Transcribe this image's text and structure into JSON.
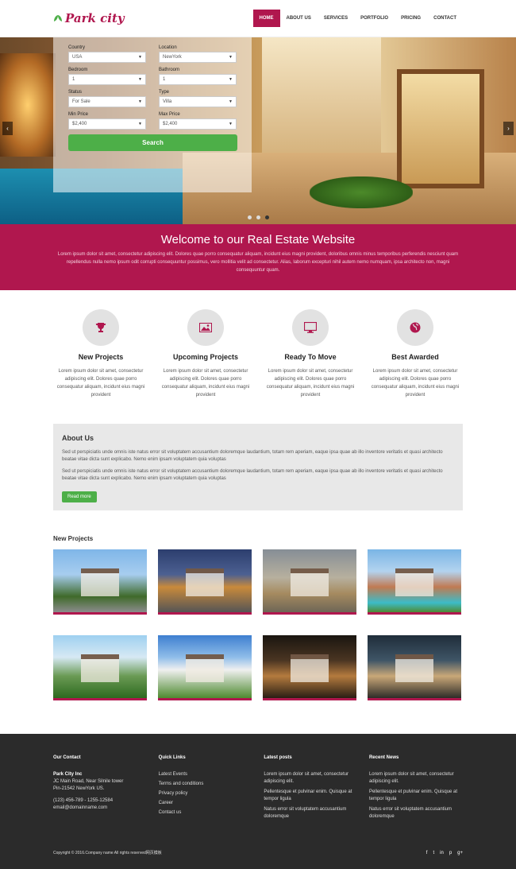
{
  "brand": {
    "name": "Park city",
    "accent": "#b0174e"
  },
  "nav": {
    "items": [
      "HOME",
      "ABOUT US",
      "SERVICES",
      "PORTFOLIO",
      "PRICING",
      "CONTACT"
    ]
  },
  "search": {
    "fields": [
      {
        "label": "Country",
        "value": "USA"
      },
      {
        "label": "Location",
        "value": "NewYork"
      },
      {
        "label": "Bedroom",
        "value": "1"
      },
      {
        "label": "Bathroom",
        "value": "1"
      },
      {
        "label": "Status",
        "value": "For Sale"
      },
      {
        "label": "Type",
        "value": "Villa"
      },
      {
        "label": "Min Price",
        "value": "$2,400"
      },
      {
        "label": "Max Price",
        "value": "$2,400"
      }
    ],
    "button": "Search"
  },
  "slider": {
    "prev": "‹",
    "next": "›",
    "dots": 3,
    "active": 3
  },
  "welcome": {
    "title": "Welcome to our Real Estate Website",
    "text": "Lorem ipsum dolor sit amet, consectetur adipiscing elit. Dolores quae porro consequatur aliquam, incidunt eius magni provident, doloribus omnis minus temporibus perferendis nesciunt quam repellendus nulla nemo ipsum odit corrupti consequuntur possimus, vero mollitia velit ad consectetur. Alias, laborum excepturi nihil autem nemo numquam, ipsa architecto non, magni consequuntur quam."
  },
  "features": [
    {
      "icon": "trophy-icon",
      "glyph": "🏆",
      "title": "New Projects",
      "text": "Lorem ipsum dolor sit amet, consectetur adipiscing elit. Dolores quae porro consequatur aliquam, incidunt eius magni provident"
    },
    {
      "icon": "picture-icon",
      "glyph": "🖼",
      "title": "Upcoming Projects",
      "text": "Lorem ipsum dolor sit amet, consectetur adipiscing elit. Dolores quae porro consequatur aliquam, incidunt eius magni provident"
    },
    {
      "icon": "monitor-icon",
      "glyph": "🖥",
      "title": "Ready To Move",
      "text": "Lorem ipsum dolor sit amet, consectetur adipiscing elit. Dolores quae porro consequatur aliquam, incidunt eius magni provident"
    },
    {
      "icon": "globe-icon",
      "glyph": "🌐",
      "title": "Best Awarded",
      "text": "Lorem ipsum dolor sit amet, consectetur adipiscing elit. Dolores quae porro consequatur aliquam, incidunt eius magni provident"
    }
  ],
  "about": {
    "title": "About Us",
    "paragraphs": [
      "Sed ut perspiciatis unde omnis iste natus error sit voluptatem accusantium doloremque laudantium, totam rem aperiam, eaque ipsa quae ab illo inventore veritatis et quasi architecto beatae vitae dicta sunt explicabo. Nemo enim ipsam voluptatem quia voluptas",
      "Sed ut perspiciatis unde omnis iste natus error sit voluptatem accusantium doloremque laudantium, totam rem aperiam, eaque ipsa quae ab illo inventore veritatis et quasi architecto beatae vitae dicta sunt explicabo. Nemo enim ipsam voluptatem quia voluptas"
    ],
    "button": "Read more"
  },
  "projects": {
    "title": "New Projects",
    "count": 8
  },
  "footer": {
    "contact": {
      "title": "Our Contact",
      "company": "Park City Inc",
      "address1": "JC Main Road, Near Silnile tower",
      "address2": "Pin-21542 NewYork US.",
      "phone": "(123) 456-789 - 1255-12584",
      "email": "email@domainname.com"
    },
    "links": {
      "title": "Quick Links",
      "items": [
        "Latest Events",
        "Terms and conditions",
        "Privacy policy",
        "Career",
        "Contact us"
      ]
    },
    "latest": {
      "title": "Latest posts",
      "items": [
        "Lorem ipsum dolor sit amet, consectetur adipiscing elit.",
        "Pellentesque et pulvinar enim. Quisque at tempor ligula",
        "Natus error sit voluptatem accusantium doloremque"
      ]
    },
    "recent": {
      "title": "Recent News",
      "items": [
        "Lorem ipsum dolor sit amet, consectetur adipiscing elit.",
        "Pellentesque et pulvinar enim. Quisque at tempor ligula",
        "Natus error sit voluptatem accusantium doloremque"
      ]
    },
    "copyright": "Copyright © 2016.Company name All rights reserved网页模板",
    "social": [
      "f",
      "t",
      "in",
      "p",
      "g+"
    ]
  }
}
